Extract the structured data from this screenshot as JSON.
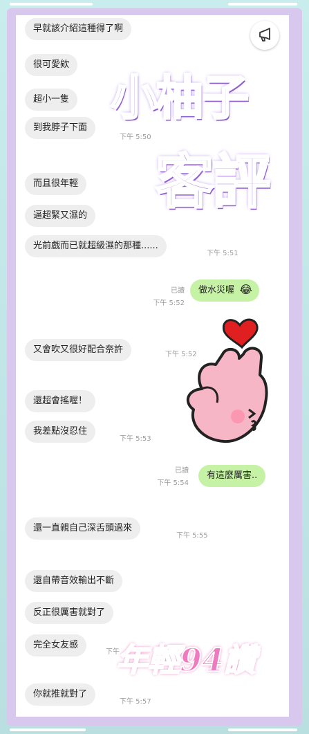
{
  "decor": {
    "title_line1": "小柚子",
    "title_line2": "客評",
    "slogan": "年輕94讚"
  },
  "messages": [
    {
      "text": "早就該介紹這種得了啊"
    },
    {
      "text": "很可愛欸"
    },
    {
      "text": "超小一隻"
    },
    {
      "text": "到我脖子下面",
      "time": "下午 5:50"
    },
    {
      "text": "而且很年輕"
    },
    {
      "text": "逼超緊又濕的"
    },
    {
      "text": "光前戲而已就超級濕的那種......",
      "time": "下午 5:51"
    },
    {
      "text": "做水災喔",
      "read": "已讀",
      "time": "下午 5:52",
      "emoji": "😂"
    },
    {
      "text": "又會吹又很好配合奈許",
      "time": "下午 5:52"
    },
    {
      "text": "還超會搖喔！"
    },
    {
      "text": "我差點沒忍住",
      "time": "下午 5:53"
    },
    {
      "text": "有這麼厲害..",
      "read": "已讀",
      "time": "下午 5:54"
    },
    {
      "text": "還一直親自己深舌頭過來",
      "time": "下午 5:55"
    },
    {
      "text": "還自帶音效輸出不斷"
    },
    {
      "text": "反正很厲害就對了"
    },
    {
      "text": "完全女友感",
      "time": "下午"
    },
    {
      "text": "你就推就對了",
      "time": "下午 5:57"
    }
  ],
  "colors": {
    "incoming_bubble": "#eeeeee",
    "outgoing_bubble": "#c6f2a6",
    "frame_purple": "#d9c8ee",
    "frame_teal": "#bfe3e3"
  },
  "icons": [
    "megaphone-icon",
    "heart-icon",
    "finger-heart-hand-icon",
    "laughing-crying-emoji-icon"
  ]
}
